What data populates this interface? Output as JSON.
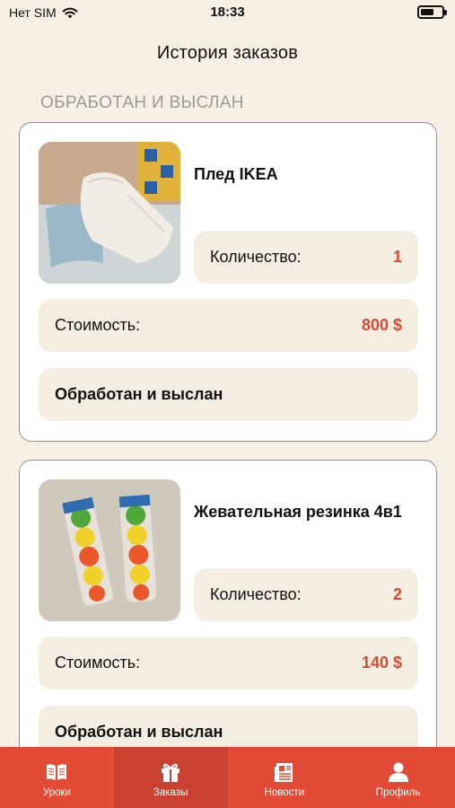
{
  "status_bar": {
    "carrier": "Нет SIM",
    "time": "18:33"
  },
  "header": {
    "title": "История заказов"
  },
  "section": {
    "label": "ОБРАБОТАН И ВЫСЛАН"
  },
  "orders": [
    {
      "name": "Плед IKEA",
      "quantity_label": "Количество:",
      "quantity": "1",
      "cost_label": "Стоимость:",
      "cost": "800 $",
      "status": "Обработан и выслан"
    },
    {
      "name": "Жевательная резинка 4в1",
      "quantity_label": "Количество:",
      "quantity": "2",
      "cost_label": "Стоимость:",
      "cost": "140 $",
      "status": "Обработан и выслан"
    }
  ],
  "tabs": [
    {
      "label": "Уроки",
      "icon": "book-icon",
      "active": false
    },
    {
      "label": "Заказы",
      "icon": "gift-icon",
      "active": true
    },
    {
      "label": "Новости",
      "icon": "newspaper-icon",
      "active": false
    },
    {
      "label": "Профиль",
      "icon": "person-icon",
      "active": false
    }
  ],
  "colors": {
    "accent": "#e24b36",
    "background": "#f5efe4",
    "pill": "#f4eee2"
  }
}
